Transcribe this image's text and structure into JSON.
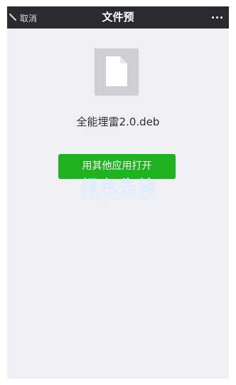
{
  "nav": {
    "back_label": "取消",
    "title": "文件预",
    "more_icon": "more-dots-icon"
  },
  "file": {
    "name": "全能埋雷2.0.deb",
    "icon": "document-icon"
  },
  "actions": {
    "open_label": "用其他应用打开"
  },
  "watermark": {
    "main": "绿色先锋",
    "sub": "www.greenxf.com"
  },
  "colors": {
    "nav_bg": "#2b2b2f",
    "page_bg": "#efeff4",
    "icon_bg": "#cfcfd3",
    "button_bg": "#1fb41f"
  }
}
